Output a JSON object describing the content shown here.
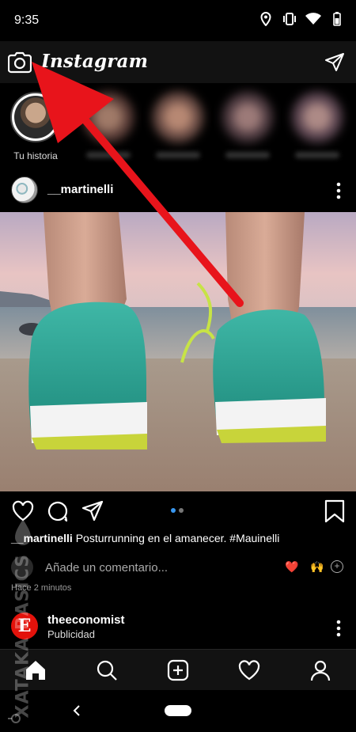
{
  "status_bar": {
    "time": "9:35",
    "icons": [
      "location-icon",
      "vibrate-icon",
      "wifi-icon",
      "battery-icon"
    ]
  },
  "header": {
    "title": "Instagram",
    "left_icon": "camera-icon",
    "right_icon": "direct-message-icon"
  },
  "stories": {
    "own_label": "Tu historia",
    "others_count_visible": 4
  },
  "post": {
    "username": "__martinelli",
    "caption_user": "__martinelli",
    "caption_text": " Posturrunning en el amanecer. #Mauinelli",
    "comment_placeholder": "Añade un comentario...",
    "emojis": [
      "❤️",
      "🙌"
    ],
    "add_emoji_label": "+",
    "timestamp": "Hace 2 minutos",
    "carousel_pages": 2,
    "carousel_active": 1
  },
  "ad": {
    "avatar_letter": "E",
    "username": "theeconomist",
    "label": "Publicidad"
  },
  "bottom_nav": {
    "items": [
      "home-icon",
      "search-icon",
      "new-post-icon",
      "activity-icon",
      "profile-icon"
    ],
    "active": "home-icon"
  },
  "watermark": {
    "text": "XATAKA BASICS"
  },
  "colors": {
    "background": "#000000",
    "header": "#121212",
    "arrow": "#e8141b",
    "accent_dot": "#3897f0",
    "ad_red": "#e3120b"
  }
}
